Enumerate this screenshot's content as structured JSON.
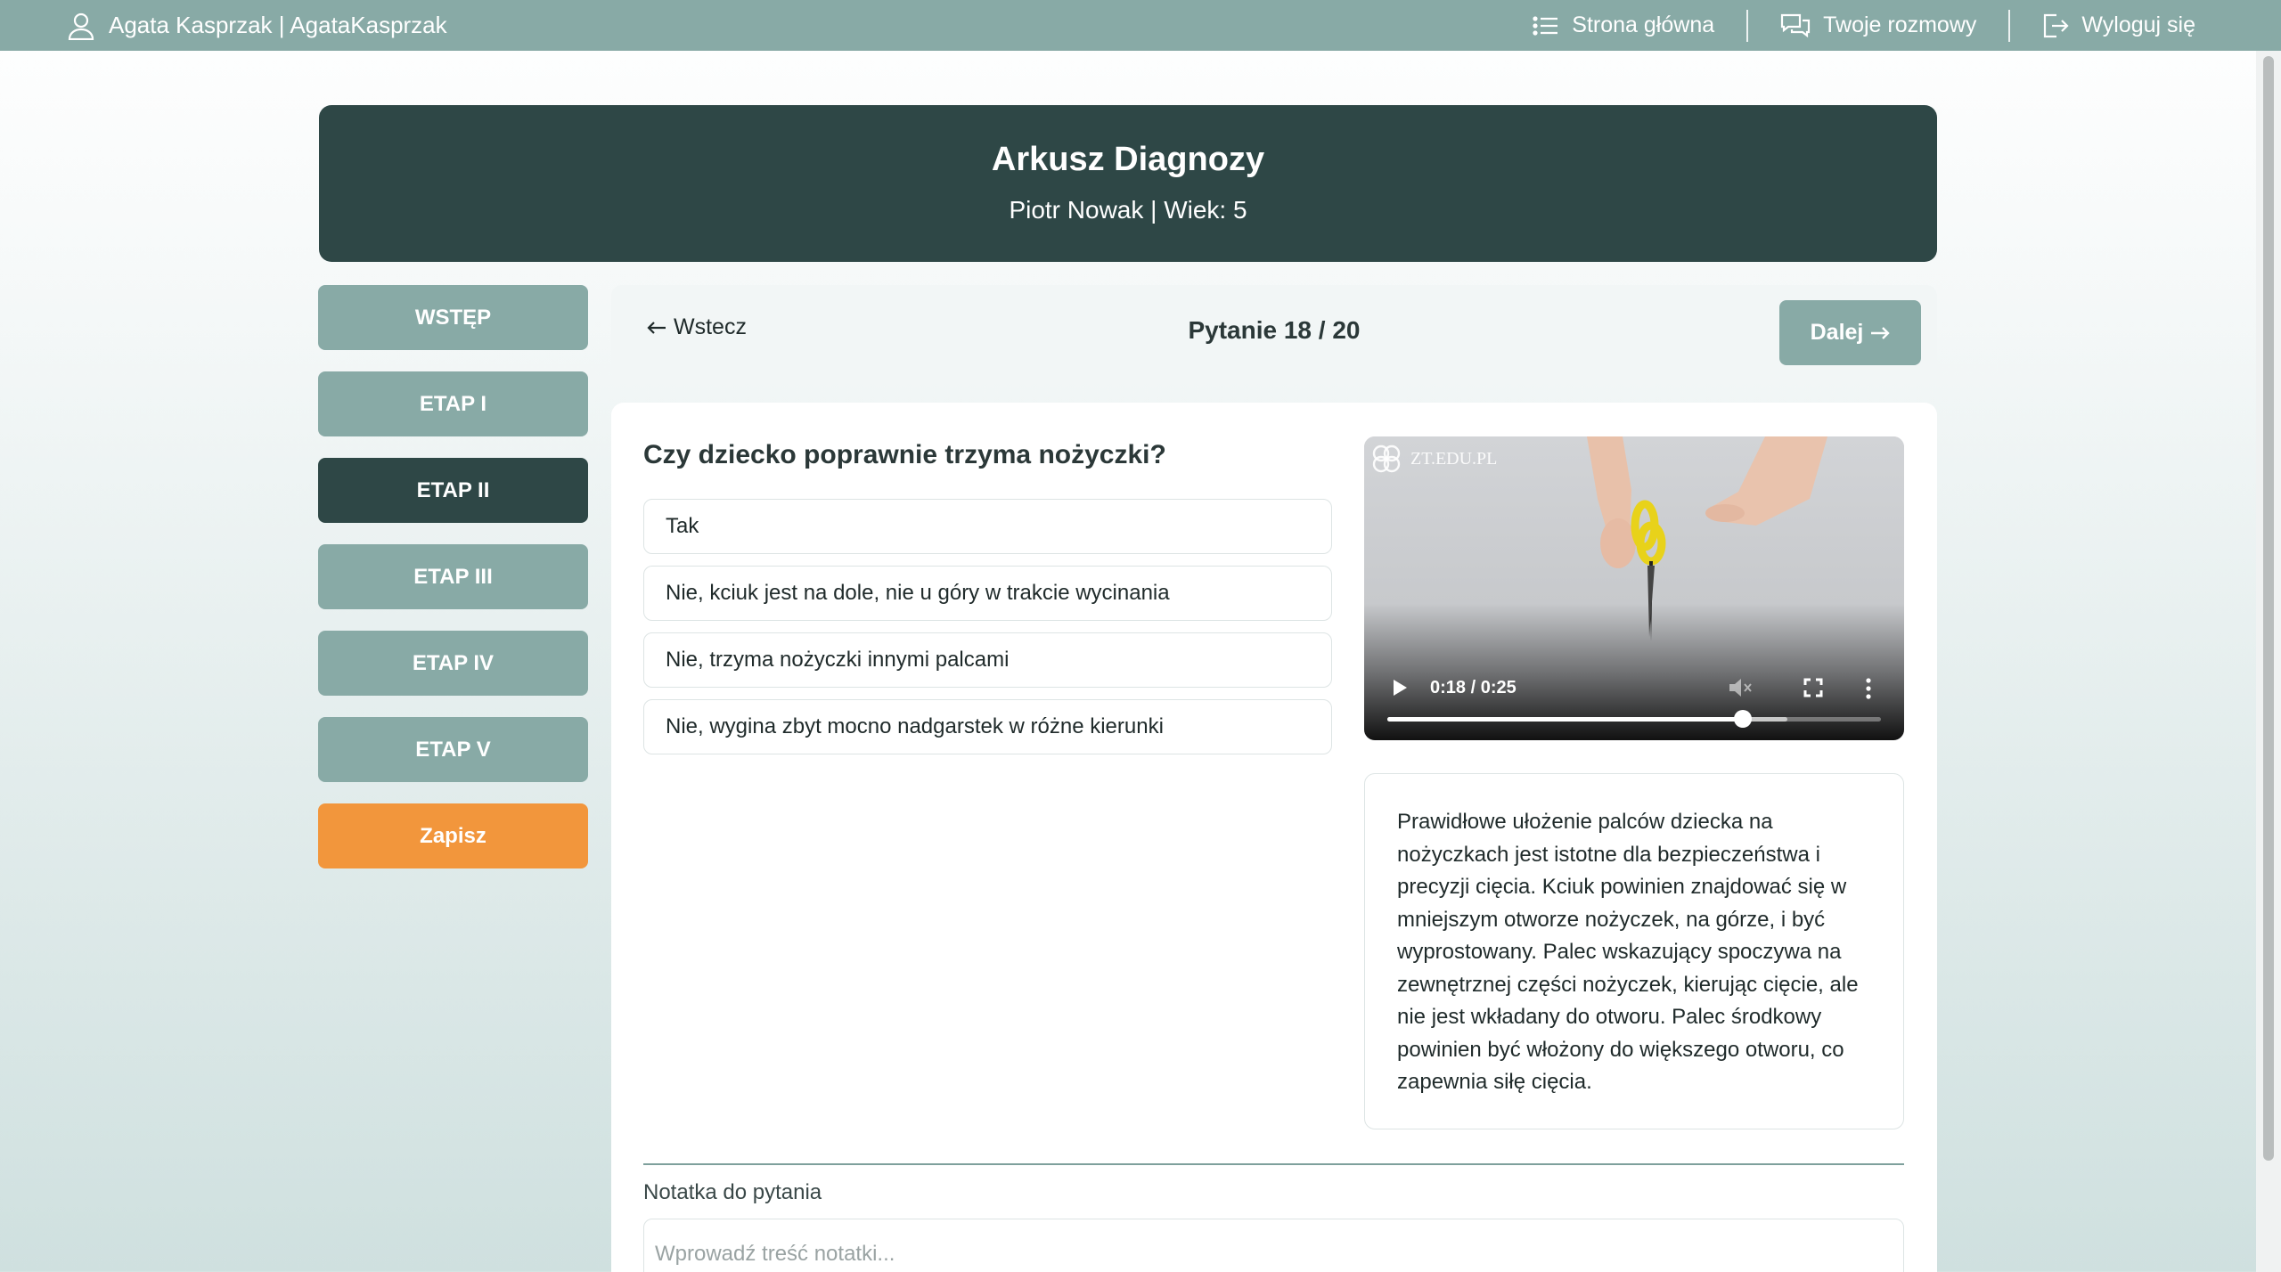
{
  "topbar": {
    "user_label": "Agata Kasprzak | AgataKasprzak",
    "nav": [
      {
        "label": "Strona główna",
        "icon": "list-icon"
      },
      {
        "label": "Twoje rozmowy",
        "icon": "chat-icon"
      },
      {
        "label": "Wyloguj się",
        "icon": "logout-icon"
      }
    ]
  },
  "header": {
    "title": "Arkusz Diagnozy",
    "subtitle": "Piotr Nowak | Wiek: 5"
  },
  "sidebar": {
    "items": [
      {
        "label": "WSTĘP",
        "active": false
      },
      {
        "label": "ETAP I",
        "active": false
      },
      {
        "label": "ETAP II",
        "active": true
      },
      {
        "label": "ETAP III",
        "active": false
      },
      {
        "label": "ETAP IV",
        "active": false
      },
      {
        "label": "ETAP V",
        "active": false
      }
    ],
    "save_label": "Zapisz"
  },
  "question_nav": {
    "back_label": "Wstecz",
    "counter": "Pytanie 18 / 20",
    "next_label": "Dalej"
  },
  "question": {
    "text": "Czy dziecko poprawnie trzyma nożyczki?",
    "answers": [
      "Tak",
      "Nie, kciuk jest na dole, nie u góry w trakcie wycinania",
      "Nie, trzyma nożyczki innymi palcami",
      "Nie, wygina zbyt mocno nadgarstek w różne kierunki"
    ]
  },
  "video": {
    "watermark": "ZT.EDU.PL",
    "time": "0:18 / 0:25",
    "progress": 0.72,
    "buffered": 0.81
  },
  "description": "Prawidłowe ułożenie palców dziecka na nożyczkach jest istotne dla bezpieczeństwa i precyzji cięcia. Kciuk powinien znajdować się w mniejszym otworze nożyczek, na górze, i być wyprostowany. Palec wskazujący spoczywa na zewnętrznej części nożyczek, kierując cięcie, ale nie jest wkładany do otworu. Palec środkowy powinien być włożony do większego otworu, co zapewnia siłę cięcia.",
  "note": {
    "label": "Notatka do pytania",
    "placeholder": "Wprowadź treść notatki...",
    "value": ""
  },
  "colors": {
    "topbar": "#88aaa6",
    "header": "#2e4746",
    "sidebar_inactive": "#88aaa6",
    "sidebar_active": "#2e4746",
    "save": "#f2963c"
  }
}
